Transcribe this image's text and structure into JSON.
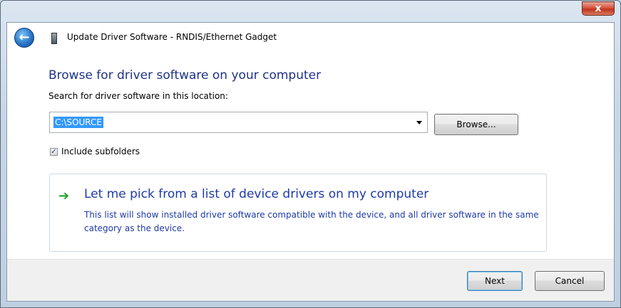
{
  "window": {
    "title": "Update Driver Software - RNDIS/Ethernet Gadget",
    "close_label": "x"
  },
  "main": {
    "heading": "Browse for driver software on your computer",
    "search_prompt": "Search for driver software in this location:",
    "location_value": "C:\\SOURCE",
    "browse_label": "Browse...",
    "include_subfolders_label": "Include subfolders",
    "include_subfolders_checked": true,
    "pick_option": {
      "title": "Let me pick from a list of device drivers on my computer",
      "description": "This list will show installed driver software compatible with the device, and all driver software in the same category as the device."
    }
  },
  "footer": {
    "next_label": "Next",
    "cancel_label": "Cancel"
  },
  "icons": {
    "back": "back-arrow-icon",
    "device": "device-icon",
    "option_arrow": "green-arrow-icon"
  },
  "colors": {
    "heading": "#1e3287",
    "link": "#1e3aa8",
    "selection": "#3399ff",
    "arrow": "#1f9e2e"
  }
}
